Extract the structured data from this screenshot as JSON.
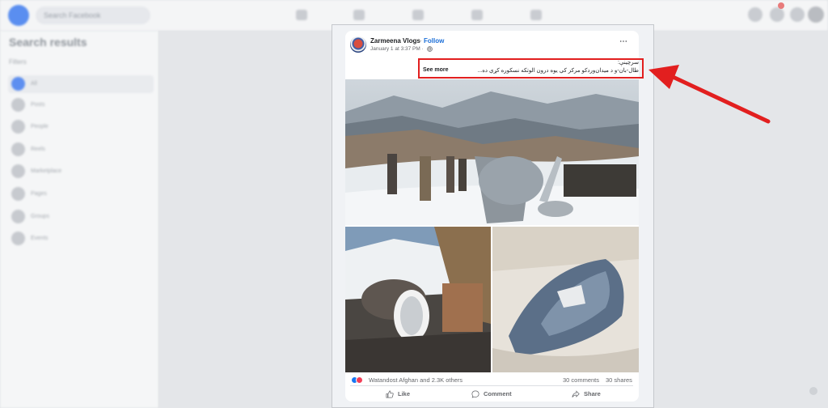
{
  "colors": {
    "highlight": "#e21f1f",
    "brand": "#1877f2",
    "follow": "#1a6ed8",
    "text_secondary": "#65676b"
  },
  "background": {
    "search_placeholder": "Search Facebook",
    "sidebar": {
      "title": "Search results",
      "filters_label": "Filters",
      "items": [
        "All",
        "Posts",
        "People",
        "Reels",
        "Marketplace",
        "Pages",
        "Groups",
        "Events"
      ]
    }
  },
  "post": {
    "author": "Zarmeena Vlogs",
    "separator": "·",
    "follow_label": "Follow",
    "timestamp": "January 1 at 3:37 PM ·",
    "more_icon": "⋯",
    "caption_line1": "سرچینې:",
    "caption_line2": "طال-بان-و د میدان‌وردکو مرکز کې یوه درون الوتکه نسکوره کړې ده...",
    "see_more_label": "See more",
    "reaction_names": "Watandost Afghan and 2.3K others",
    "comments_count": "30 comments",
    "shares_count": "30 shares",
    "actions": {
      "like": "Like",
      "comment": "Comment",
      "share": "Share"
    }
  }
}
